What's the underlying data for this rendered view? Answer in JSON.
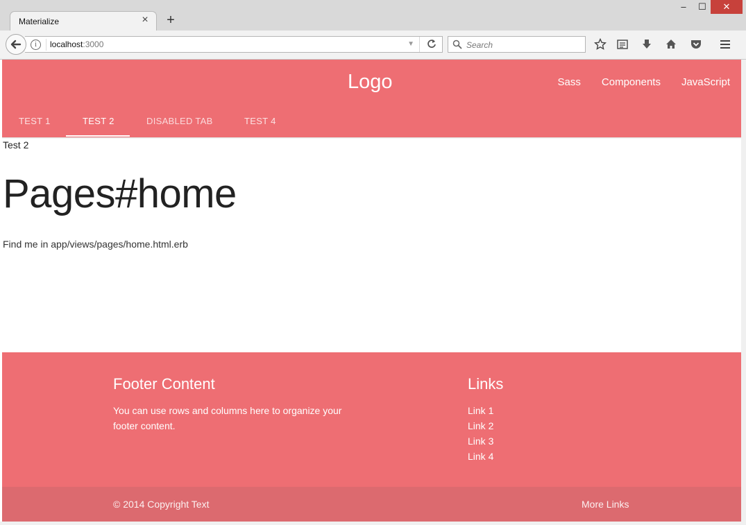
{
  "browser": {
    "tab_title": "Materialize",
    "url_host": "localhost",
    "url_port": ":3000",
    "search_placeholder": "Search",
    "window_controls": {
      "minimize": "–",
      "maximize": "☐",
      "close": "✕"
    }
  },
  "header": {
    "logo": "Logo",
    "nav": [
      "Sass",
      "Components",
      "JavaScript"
    ],
    "tabs": [
      {
        "label": "TEST 1",
        "state": "normal"
      },
      {
        "label": "TEST 2",
        "state": "active"
      },
      {
        "label": "DISABLED TAB",
        "state": "disabled"
      },
      {
        "label": "TEST 4",
        "state": "normal"
      }
    ]
  },
  "main": {
    "tab_content": "Test 2",
    "heading": "Pages#home",
    "description": "Find me in app/views/pages/home.html.erb"
  },
  "footer": {
    "content_title": "Footer Content",
    "content_text": "You can use rows and columns here to organize your footer content.",
    "links_title": "Links",
    "links": [
      "Link 1",
      "Link 2",
      "Link 3",
      "Link 4"
    ],
    "copyright": "© 2014 Copyright Text",
    "more_links": "More Links"
  },
  "colors": {
    "primary": "#ee6e73",
    "primary_dark": "#dc6a6f",
    "text": "#222222"
  }
}
